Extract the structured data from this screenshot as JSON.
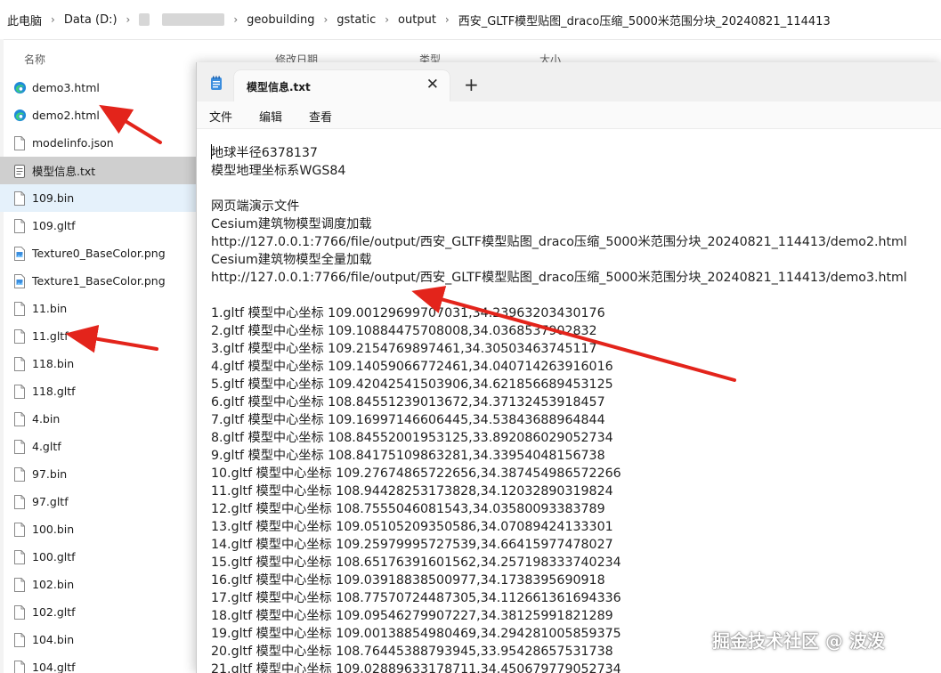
{
  "breadcrumb": {
    "items": [
      "此电脑",
      "Data (D:)",
      "geobuilding",
      "gstatic",
      "output",
      "西安_GLTF模型贴图_draco压缩_5000米范围分块_20240821_114413"
    ]
  },
  "columns": {
    "name": "名称",
    "modified": "修改日期",
    "type": "类型",
    "size": "大小"
  },
  "files": [
    {
      "name": "demo3.html",
      "icon": "edge-icon"
    },
    {
      "name": "demo2.html",
      "icon": "edge-icon"
    },
    {
      "name": "modelinfo.json",
      "icon": "file-icon"
    },
    {
      "name": "模型信息.txt",
      "icon": "notepad-icon"
    },
    {
      "name": "109.bin",
      "icon": "file-icon"
    },
    {
      "name": "109.gltf",
      "icon": "file-icon"
    },
    {
      "name": "Texture0_BaseColor.png",
      "icon": "image-icon"
    },
    {
      "name": "Texture1_BaseColor.png",
      "icon": "image-icon"
    },
    {
      "name": "11.bin",
      "icon": "file-icon"
    },
    {
      "name": "11.gltf",
      "icon": "file-icon"
    },
    {
      "name": "118.bin",
      "icon": "file-icon"
    },
    {
      "name": "118.gltf",
      "icon": "file-icon"
    },
    {
      "name": "4.bin",
      "icon": "file-icon"
    },
    {
      "name": "4.gltf",
      "icon": "file-icon"
    },
    {
      "name": "97.bin",
      "icon": "file-icon"
    },
    {
      "name": "97.gltf",
      "icon": "file-icon"
    },
    {
      "name": "100.bin",
      "icon": "file-icon"
    },
    {
      "name": "100.gltf",
      "icon": "file-icon"
    },
    {
      "name": "102.bin",
      "icon": "file-icon"
    },
    {
      "name": "102.gltf",
      "icon": "file-icon"
    },
    {
      "name": "104.bin",
      "icon": "file-icon"
    },
    {
      "name": "104.gltf",
      "icon": "file-icon"
    }
  ],
  "notepad": {
    "tab_title": "模型信息.txt",
    "close_glyph": "✕",
    "newtab_glyph": "+",
    "menu": {
      "file": "文件",
      "edit": "编辑",
      "view": "查看"
    },
    "lines": [
      "地球半径6378137",
      "模型地理坐标系WGS84",
      "",
      "网页端演示文件",
      "Cesium建筑物模型调度加载",
      "http://127.0.0.1:7766/file/output/西安_GLTF模型贴图_draco压缩_5000米范围分块_20240821_114413/demo2.html",
      "Cesium建筑物模型全量加载",
      "http://127.0.0.1:7766/file/output/西安_GLTF模型贴图_draco压缩_5000米范围分块_20240821_114413/demo3.html",
      "",
      "1.gltf 模型中心坐标 109.00129699707031,34.23963203430176",
      "2.gltf 模型中心坐标 109.10884475708008,34.0368537902832",
      "3.gltf 模型中心坐标 109.2154769897461,34.30503463745117",
      "4.gltf 模型中心坐标 109.14059066772461,34.040714263916016",
      "5.gltf 模型中心坐标 109.42042541503906,34.621856689453125",
      "6.gltf 模型中心坐标 108.84551239013672,34.37132453918457",
      "7.gltf 模型中心坐标 109.16997146606445,34.53843688964844",
      "8.gltf 模型中心坐标 108.84552001953125,33.892086029052734",
      "9.gltf 模型中心坐标 108.84175109863281,34.33954048156738",
      "10.gltf 模型中心坐标 109.27674865722656,34.387454986572266",
      "11.gltf 模型中心坐标 108.94428253173828,34.12032890319824",
      "12.gltf 模型中心坐标 108.7555046081543,34.03580093383789",
      "13.gltf 模型中心坐标 109.05105209350586,34.07089424133301",
      "14.gltf 模型中心坐标 109.25979995727539,34.66415977478027",
      "15.gltf 模型中心坐标 108.65176391601562,34.257198333740234",
      "16.gltf 模型中心坐标 109.03918838500977,34.1738395690918",
      "17.gltf 模型中心坐标 108.77570724487305,34.112661361694336",
      "18.gltf 模型中心坐标 109.09546279907227,34.38125991821289",
      "19.gltf 模型中心坐标 109.00138854980469,34.294281005859375",
      "20.gltf 模型中心坐标 108.76445388793945,33.95428657531738",
      "21.gltf 模型中心坐标 109.02889633178711,34.450679779052734"
    ]
  },
  "watermark": "掘金技术社区 @ 波泼",
  "colors": {
    "arrow": "#e3241b",
    "selected_row": "#cfcfcf",
    "hover_row": "#e5f1fb"
  }
}
